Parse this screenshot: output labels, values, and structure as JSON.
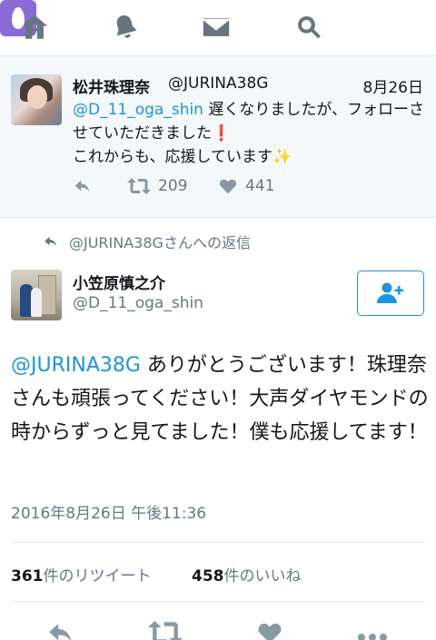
{
  "nav": {
    "icons": [
      "home-icon",
      "bell-icon",
      "mail-icon",
      "search-icon",
      "profile-icon"
    ],
    "profile_color": "#8a6bd6"
  },
  "tweet1": {
    "name": "松井珠理奈",
    "handle": "@JURINA38G",
    "date": "8月26日",
    "mention": "@D_11_oga_shin",
    "text_a": " 遅くなりましたが、フォローさせていただきました",
    "bang": "❗",
    "text_b": "これからも、応援しています",
    "sparkle": "✨",
    "retweets": "209",
    "likes": "441"
  },
  "reply_context": "@JURINA38Gさんへの返信",
  "main": {
    "name": "小笠原慎之介",
    "handle": "@D_11_oga_shin",
    "mention": "@JURINA38G",
    "text": " ありがとうございます！珠理奈さんも頑張ってください！大声ダイヤモンドの時からずっと見てました！僕も応援してます！",
    "timestamp": "2016年8月26日 午後11:36",
    "retweet_count": "361",
    "retweet_label": "件のリツイート",
    "like_count": "458",
    "like_label": "件のいいね"
  },
  "colors": {
    "accent": "#1b95e0",
    "muted": "#657786",
    "gray_bg": "#f5f8fa"
  }
}
